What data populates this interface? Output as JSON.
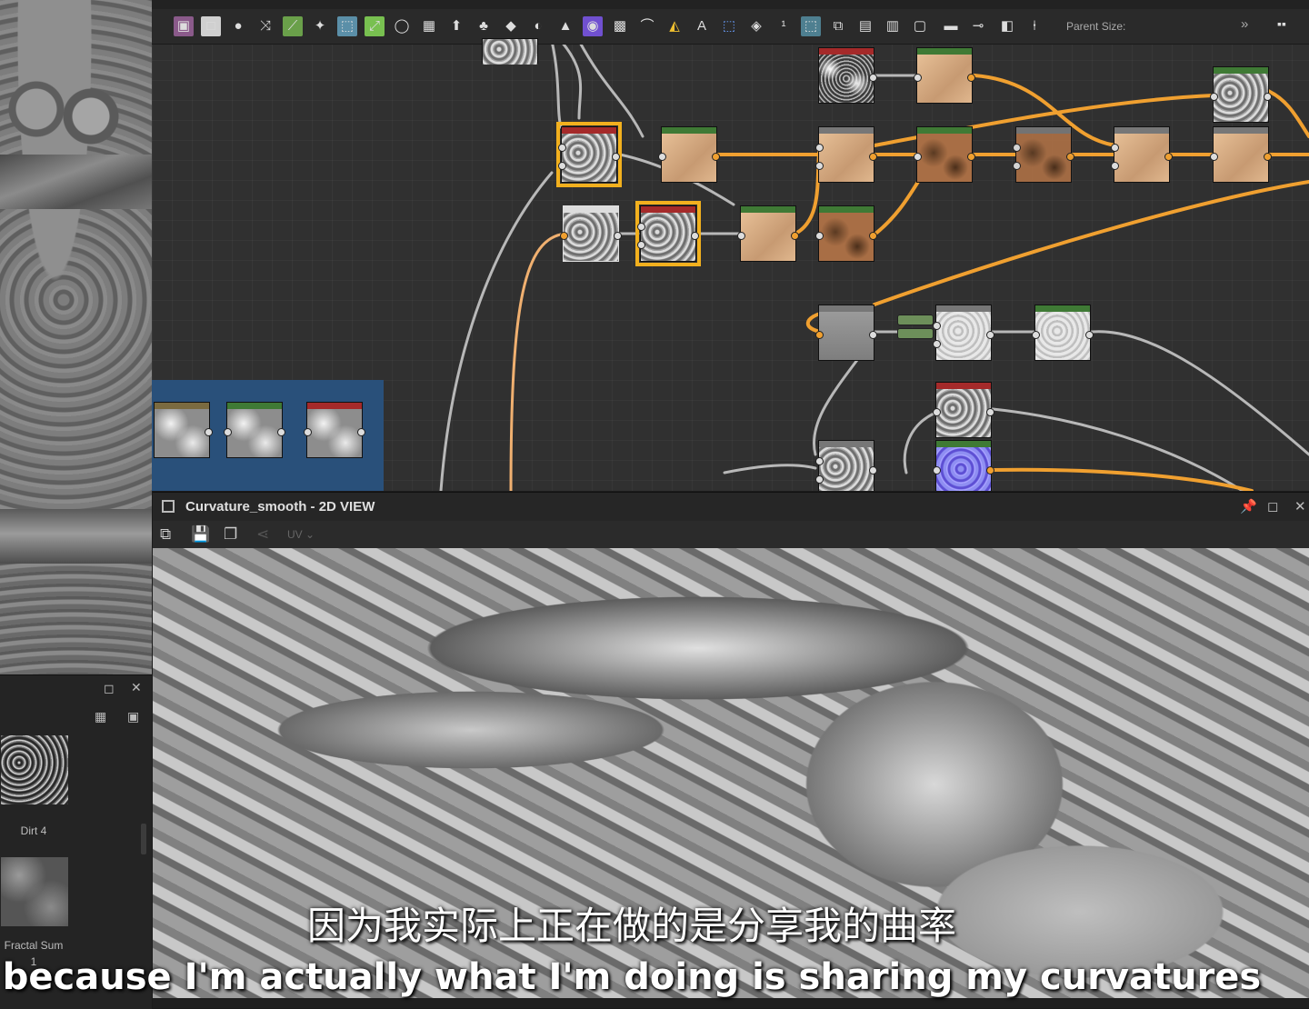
{
  "graph": {
    "toolbar": {
      "parent_size_label": "Parent Size:",
      "more_label": "»"
    }
  },
  "view2d": {
    "title": "Curvature_smooth - 2D VIEW",
    "channel_label": "UV ⌄"
  },
  "library": {
    "items": [
      {
        "label": "Dirt 4"
      },
      {
        "label": "Fractal Sum",
        "sublabel": "1"
      }
    ]
  },
  "subtitles": {
    "chinese": "因为我实际上正在做的是分享我的曲率",
    "english": "because I'm actually what I'm doing is sharing my curvatures"
  },
  "colors": {
    "wire_orange": "#f0a030",
    "wire_grey": "#b8b8b8",
    "selection": "#f2b01e",
    "frame_blue": "#29507a"
  }
}
